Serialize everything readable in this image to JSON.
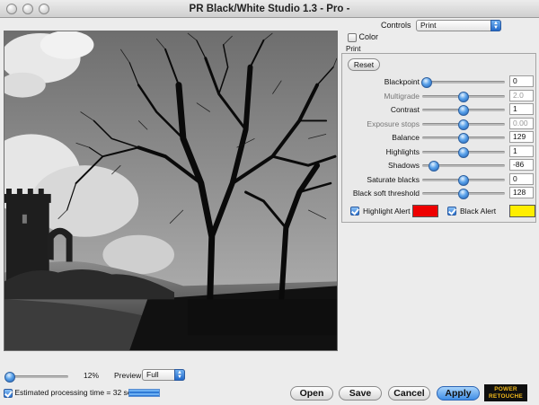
{
  "window": {
    "title": "PR Black/White Studio 1.3 - Pro -"
  },
  "controls": {
    "label": "Controls",
    "selected": "Print"
  },
  "color_toggle": {
    "label": "Color",
    "checked": false
  },
  "section_label": "Print",
  "reset_label": "Reset",
  "sliders": [
    {
      "label": "Blackpoint",
      "value": "0",
      "level": 0.05,
      "dim": false
    },
    {
      "label": "Multigrade",
      "value": "2.0",
      "level": 0.5,
      "dim": true
    },
    {
      "label": "Contrast",
      "value": "1",
      "level": 0.5,
      "dim": false
    },
    {
      "label": "Exposure stops",
      "value": "0.00",
      "level": 0.5,
      "dim": true
    },
    {
      "label": "Balance",
      "value": "129",
      "level": 0.5,
      "dim": false
    },
    {
      "label": "Highlights",
      "value": "1",
      "level": 0.5,
      "dim": false
    },
    {
      "label": "Shadows",
      "value": "-86",
      "level": 0.14,
      "dim": false
    },
    {
      "label": "Saturate blacks",
      "value": "0",
      "level": 0.5,
      "dim": false
    },
    {
      "label": "Black soft threshold",
      "value": "128",
      "level": 0.5,
      "dim": false
    }
  ],
  "alerts": {
    "highlight": {
      "label": "Highlight Alert",
      "checked": true,
      "color": "#ee0000"
    },
    "black": {
      "label": "Black Alert",
      "checked": true,
      "color": "#ffee00"
    }
  },
  "zoom": {
    "value": "12%",
    "level": 0.07
  },
  "preview": {
    "label": "Preview",
    "selected": "Full"
  },
  "estimate": {
    "label": "Estimated processing time = 32 sec.",
    "checked": true,
    "progress": 1.0
  },
  "buttons": {
    "open": "Open",
    "save": "Save",
    "cancel": "Cancel",
    "apply": "Apply"
  },
  "logo": {
    "line1": "POWER",
    "line2": "RETOUCHE"
  }
}
